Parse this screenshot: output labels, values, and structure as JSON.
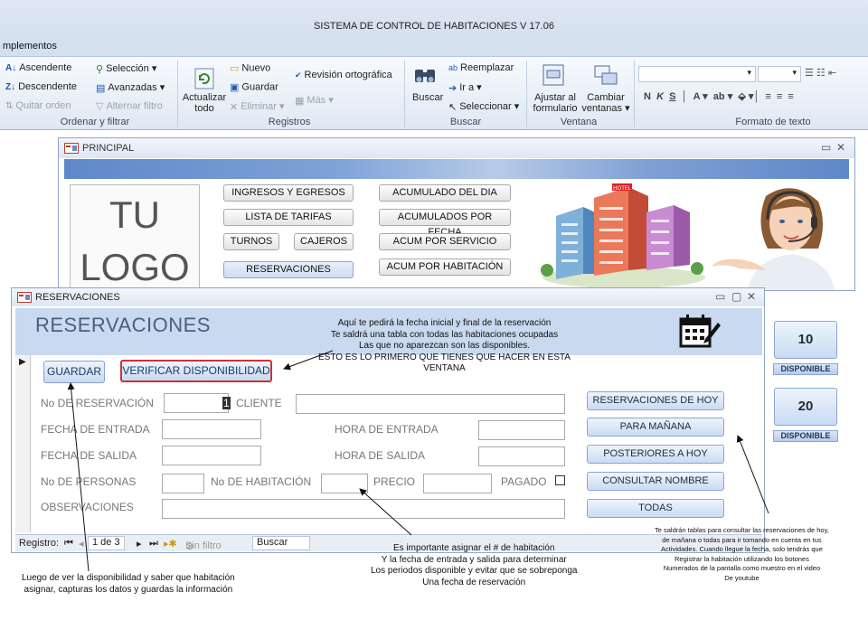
{
  "window_title": "SISTEMA DE CONTROL DE HABITACIONES V 17.06",
  "ribbon_tab": "mplementos",
  "ribbon": {
    "sort": {
      "asc": "Ascendente",
      "desc": "Descendente",
      "clear": "Quitar orden",
      "selection": "Selección",
      "advanced": "Avanzadas",
      "toggle_filter": "Alternar filtro",
      "group": "Ordenar y filtrar"
    },
    "records": {
      "refresh": "Actualizar todo",
      "new": "Nuevo",
      "save": "Guardar",
      "delete": "Eliminar",
      "spelling": "Revisión ortográfica",
      "more": "Más",
      "group": "Registros"
    },
    "find": {
      "search": "Buscar",
      "replace": "Reemplazar",
      "goto": "Ir a",
      "select": "Seleccionar",
      "group": "Buscar"
    },
    "window": {
      "fit": "Ajustar al formulario",
      "switch": "Cambiar ventanas",
      "group": "Ventana"
    },
    "text_format": {
      "group": "Formato de texto"
    }
  },
  "principal": {
    "title": "PRINCIPAL",
    "logo_line1": "TU",
    "logo_line2": "LOGO",
    "buttons": {
      "ingresos": "INGRESOS Y EGRESOS",
      "tarifas": "LISTA DE TARIFAS",
      "turnos": "TURNOS",
      "cajeros": "CAJEROS",
      "reservaciones": "RESERVACIONES",
      "acum_dia": "ACUMULADO DEL DIA",
      "acum_fecha": "ACUMULADOS POR FECHA",
      "acum_servicio": "ACUM POR SERVICIO",
      "acum_habitacion": "ACUM POR HABITACIÓN"
    },
    "rooms": [
      {
        "number": "10",
        "status": "DISPONIBLE"
      },
      {
        "number": "20",
        "status": "DISPONIBLE"
      }
    ]
  },
  "reservaciones": {
    "window_title": "RESERVACIONES",
    "header": "RESERVACIONES",
    "guardar": "GUARDAR",
    "verificar": "VERIFICAR DISPONIBILIDAD",
    "labels": {
      "no_reservacion": "No DE RESERVACIÓN",
      "cliente": "CLIENTE",
      "fecha_entrada": "FECHA DE ENTRADA",
      "hora_entrada": "HORA DE ENTRADA",
      "fecha_salida": "FECHA DE SALIDA",
      "hora_salida": "HORA DE SALIDA",
      "personas": "No DE PERSONAS",
      "habitacion": "No DE HABITACIÓN",
      "precio": "PRECIO",
      "pagado": "PAGADO",
      "observaciones": "OBSERVACIONES"
    },
    "no_reservacion_value": "1",
    "side_buttons": {
      "hoy": "RESERVACIONES DE HOY",
      "manana": "PARA MAÑANA",
      "posteriores": "POSTERIORES A HOY",
      "consultar": "CONSULTAR NOMBRE",
      "todas": "TODAS"
    },
    "navbar": {
      "registro": "Registro:",
      "position": "1 de 3",
      "filter": "Sin filtro",
      "search": "Buscar"
    }
  },
  "annotations": {
    "top": [
      "Aquí te pedirá la  fecha inicial y final de la reservación",
      "Te saldrá una tabla con todas las habitaciones ocupadas",
      "Las que no aparezcan son las disponibles.",
      "ESTO ES LO PRIMERO QUE TIENES QUE HACER EN ESTA",
      "VENTANA"
    ],
    "bottom_center": [
      "Es importante asignar  el # de habitación",
      "Y la fecha de entrada y salida para determinar",
      "Los periodos disponible y evitar que se sobreponga",
      "Una fecha de reservación"
    ],
    "bottom_left": [
      "Luego de ver  la disponibilidad y saber que habitación",
      "asignar, capturas los datos y guardas la información"
    ],
    "bottom_right": [
      "Te saldrán tablas para  consultar las reservaciones  de hoy,",
      "de mañana o todas para ir tomando en cuenta en tus",
      "Actividades.  Cuando llegue la fecha, solo tendrás que",
      "Registrar  la habitación  utilizando los botones",
      "Numerados de la pantalla  como muestro  en el video",
      "De youtube"
    ]
  }
}
